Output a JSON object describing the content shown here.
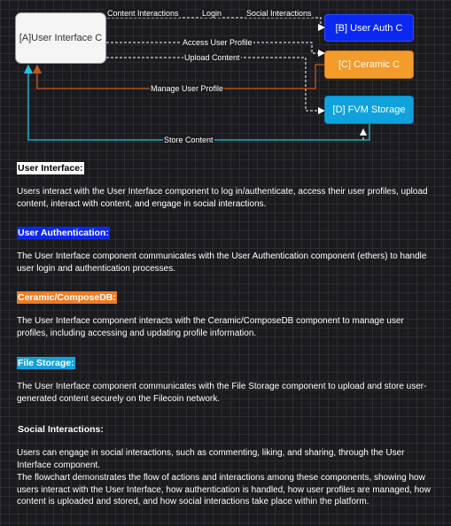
{
  "diagram": {
    "nodes": {
      "a": "[A]User Interface C",
      "b": "[B] User Auth C",
      "c": "[C] Ceramic C",
      "d": "[D] FVM Storage"
    },
    "edges": {
      "content_interactions": "Content Interactions",
      "login": "Login",
      "social_interactions": "Social Interactions",
      "access_user_profile": "Access User Profile",
      "upload_content": "Upload Content",
      "manage_user_profile": "Manage User Profile",
      "store_content": "Store Content"
    },
    "colors": {
      "auth": "#0b28f0",
      "ceramic": "#f39b2b",
      "storage": "#10a2dc",
      "manage_arrow": "#c4581c",
      "store_arrow": "#20c4e0"
    }
  },
  "sections": [
    {
      "heading": "User Interface:",
      "body": "Users interact with the User Interface component to log in/authenticate, access their user profiles, upload content, interact with content, and engage in social interactions."
    },
    {
      "heading": "User Authentication:",
      "body": "The User Interface component communicates with the User Authentication component (ethers) to handle user login and authentication processes."
    },
    {
      "heading": "Ceramic/ComposeDB:",
      "body": "The User Interface component interacts with the Ceramic/ComposeDB component to manage user profiles, including accessing and updating profile information."
    },
    {
      "heading": "File Storage:",
      "body": "The User Interface component communicates with the File Storage component to upload and store user-generated content securely on the Filecoin network."
    },
    {
      "heading": "Social Interactions:",
      "body": "Users can engage in social interactions, such as commenting, liking, and sharing, through the User Interface component."
    }
  ],
  "summary": "The flowchart demonstrates the flow of actions and interactions among these components, showing how users interact with the User Interface, how authentication is handled, how user profiles are managed, how content is uploaded and stored, and how social interactions take place within the platform."
}
